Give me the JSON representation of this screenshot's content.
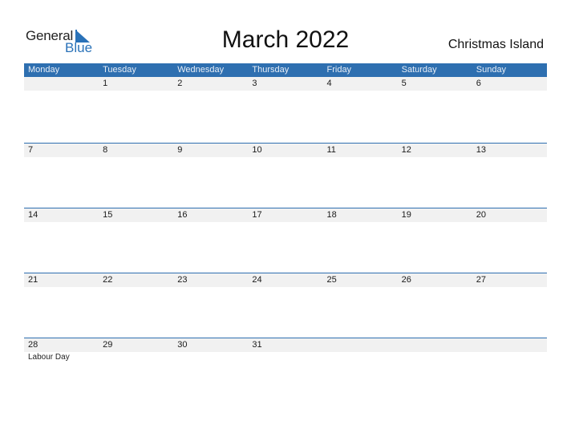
{
  "logo": {
    "word1": "General",
    "word2": "Blue",
    "icon": "triangle-flag-icon"
  },
  "title": "March 2022",
  "region": "Christmas Island",
  "colors": {
    "header_bg": "#2e6fb0",
    "header_text": "#e8eef6",
    "row_bg": "#f1f1f1",
    "logo_blue": "#2a72b8"
  },
  "weekdays": [
    "Monday",
    "Tuesday",
    "Wednesday",
    "Thursday",
    "Friday",
    "Saturday",
    "Sunday"
  ],
  "weeks": [
    {
      "days": [
        "",
        "1",
        "2",
        "3",
        "4",
        "5",
        "6"
      ],
      "events": [
        "",
        "",
        "",
        "",
        "",
        "",
        ""
      ]
    },
    {
      "days": [
        "7",
        "8",
        "9",
        "10",
        "11",
        "12",
        "13"
      ],
      "events": [
        "",
        "",
        "",
        "",
        "",
        "",
        ""
      ]
    },
    {
      "days": [
        "14",
        "15",
        "16",
        "17",
        "18",
        "19",
        "20"
      ],
      "events": [
        "",
        "",
        "",
        "",
        "",
        "",
        ""
      ]
    },
    {
      "days": [
        "21",
        "22",
        "23",
        "24",
        "25",
        "26",
        "27"
      ],
      "events": [
        "",
        "",
        "",
        "",
        "",
        "",
        ""
      ]
    },
    {
      "days": [
        "28",
        "29",
        "30",
        "31",
        "",
        "",
        ""
      ],
      "events": [
        "Labour Day",
        "",
        "",
        "",
        "",
        "",
        ""
      ]
    }
  ]
}
